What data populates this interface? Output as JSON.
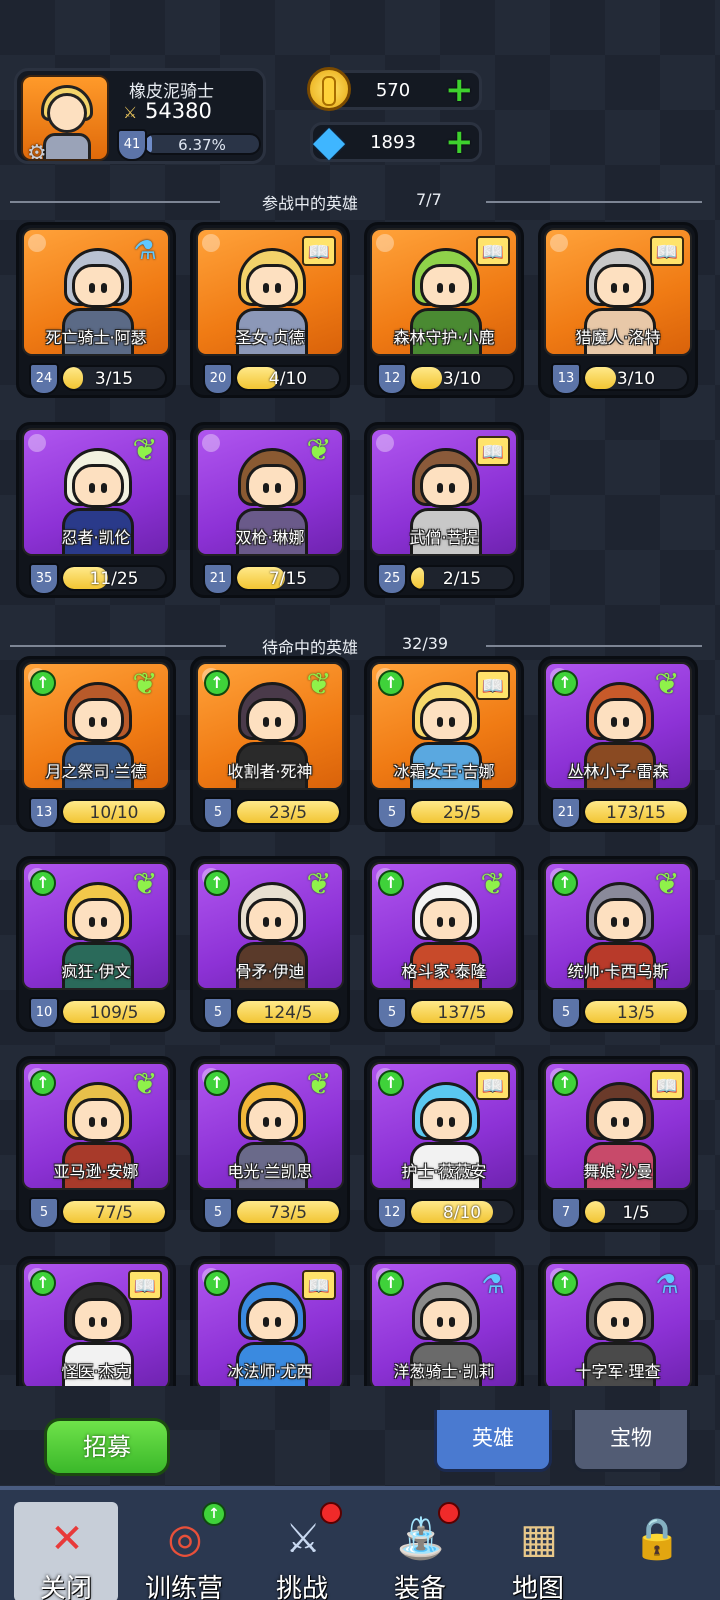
{
  "player": {
    "name": "橡皮泥骑士",
    "power": "54380",
    "level": "41",
    "exp_percent": "6.37%",
    "exp_fraction": 0.0637
  },
  "resources": {
    "coins": "570",
    "gems": "1893"
  },
  "icons": {
    "settings": "gear-icon",
    "power": "crossed-swords-icon",
    "coin": "gold-coin-icon",
    "gem": "diamond-icon",
    "add": "plus-icon"
  },
  "active_section": {
    "title": "参战中的英雄",
    "count": "7/7"
  },
  "active_heroes": [
    {
      "name": "死亡骑士·阿瑟",
      "level": "24",
      "progress": "3/15",
      "frac": 0.2,
      "rarity": "orange",
      "badge": "potion",
      "hair": "#b9c2d2",
      "outfit": "#5b6a86"
    },
    {
      "name": "圣女·贞德",
      "level": "20",
      "progress": "4/10",
      "frac": 0.4,
      "rarity": "orange",
      "badge": "book",
      "hair": "#f2d26a",
      "outfit": "#8c98b8"
    },
    {
      "name": "森林守护·小鹿",
      "level": "12",
      "progress": "3/10",
      "frac": 0.3,
      "rarity": "orange",
      "badge": "book",
      "hair": "#8fd24a",
      "outfit": "#4a8a32"
    },
    {
      "name": "猎魔人·洛特",
      "level": "13",
      "progress": "3/10",
      "frac": 0.3,
      "rarity": "orange",
      "badge": "book",
      "hair": "#c8c8c8",
      "outfit": "#e8c8a8"
    },
    {
      "name": "忍者·凯伦",
      "level": "35",
      "progress": "11/25",
      "frac": 0.44,
      "rarity": "purple",
      "badge": "wing",
      "hair": "#f2f2e0",
      "outfit": "#2a3a8a"
    },
    {
      "name": "双枪·琳娜",
      "level": "21",
      "progress": "7/15",
      "frac": 0.47,
      "rarity": "purple",
      "badge": "wing",
      "hair": "#8a5a32",
      "outfit": "#6a5a8a"
    },
    {
      "name": "武僧·菩提",
      "level": "25",
      "progress": "2/15",
      "frac": 0.13,
      "rarity": "purple",
      "badge": "book",
      "hair": "#8a5a3a",
      "outfit": "#c8c8c8"
    }
  ],
  "standby_section": {
    "title": "待命中的英雄",
    "count": "32/39"
  },
  "standby_heroes": [
    {
      "name": "月之祭司·兰德",
      "level": "13",
      "progress": "10/10",
      "frac": 1,
      "rarity": "orange",
      "badge": "wing",
      "hair": "#b85a2a",
      "outfit": "#3a5a8a"
    },
    {
      "name": "收割者·死神",
      "level": "5",
      "progress": "23/5",
      "frac": 1,
      "rarity": "orange",
      "badge": "wing",
      "hair": "#4a3a4a",
      "outfit": "#2a2a2a"
    },
    {
      "name": "冰霜女王·吉娜",
      "level": "5",
      "progress": "25/5",
      "frac": 1,
      "rarity": "orange",
      "badge": "book",
      "hair": "#f6d86a",
      "outfit": "#5aa8e0"
    },
    {
      "name": "丛林小子·雷森",
      "level": "21",
      "progress": "173/15",
      "frac": 1,
      "rarity": "purple",
      "badge": "wing",
      "hair": "#c85a2a",
      "outfit": "#8a4a22"
    },
    {
      "name": "疯狂·伊文",
      "level": "10",
      "progress": "109/5",
      "frac": 1,
      "rarity": "purple",
      "badge": "wing",
      "hair": "#f2c84a",
      "outfit": "#2a6a5a"
    },
    {
      "name": "骨矛·伊迪",
      "level": "5",
      "progress": "124/5",
      "frac": 1,
      "rarity": "purple",
      "badge": "wing",
      "hair": "#e8e0d0",
      "outfit": "#5a3a2a"
    },
    {
      "name": "格斗家·泰隆",
      "level": "5",
      "progress": "137/5",
      "frac": 1,
      "rarity": "purple",
      "badge": "wing",
      "hair": "#f2f2f2",
      "outfit": "#c84a2a"
    },
    {
      "name": "统帅·卡西乌斯",
      "level": "5",
      "progress": "13/5",
      "frac": 1,
      "rarity": "purple",
      "badge": "wing",
      "hair": "#8a8a9a",
      "outfit": "#b83a2a"
    },
    {
      "name": "亚马逊·安娜",
      "level": "5",
      "progress": "77/5",
      "frac": 1,
      "rarity": "purple",
      "badge": "wing",
      "hair": "#e8c04a",
      "outfit": "#a83a2a"
    },
    {
      "name": "电光·兰凯思",
      "level": "5",
      "progress": "73/5",
      "frac": 1,
      "rarity": "purple",
      "badge": "wing",
      "hair": "#f2b83a",
      "outfit": "#6a6a8a"
    },
    {
      "name": "护士·薇薇安",
      "level": "12",
      "progress": "8/10",
      "frac": 0.8,
      "rarity": "purple",
      "badge": "book",
      "hair": "#5ac8f0",
      "outfit": "#f2f2f2"
    },
    {
      "name": "舞娘·沙曼",
      "level": "7",
      "progress": "1/5",
      "frac": 0.2,
      "rarity": "purple",
      "badge": "book",
      "hair": "#6a3a2a",
      "outfit": "#c84a6a"
    },
    {
      "name": "怪医·杰克",
      "level": "",
      "progress": "",
      "frac": 0,
      "rarity": "purple",
      "badge": "book",
      "hair": "#2a2a2a",
      "outfit": "#f2f2f2"
    },
    {
      "name": "冰法师·尤西",
      "level": "",
      "progress": "",
      "frac": 0,
      "rarity": "purple",
      "badge": "book",
      "hair": "#3a8ae0",
      "outfit": "#3a8ae0"
    },
    {
      "name": "洋葱骑士·凯莉",
      "level": "",
      "progress": "",
      "frac": 0,
      "rarity": "purple",
      "badge": "potion",
      "hair": "#8a8a8a",
      "outfit": "#6a6a6a"
    },
    {
      "name": "十字军·理查",
      "level": "",
      "progress": "",
      "frac": 0,
      "rarity": "purple",
      "badge": "potion",
      "hair": "#5a5a5a",
      "outfit": "#4a4a4a"
    }
  ],
  "actions": {
    "recruit": "招募",
    "tab_heroes": "英雄",
    "tab_treasure": "宝物"
  },
  "nav": [
    {
      "label": "关闭",
      "icon": "close-icon",
      "glyph": "✕",
      "color": "#e83a3a"
    },
    {
      "label": "训练营",
      "icon": "training-target-icon",
      "glyph": "◎",
      "color": "#e8503a",
      "notify": "up"
    },
    {
      "label": "挑战",
      "icon": "sword-icon",
      "glyph": "⚔",
      "color": "#c8d8f0",
      "notify": "dot"
    },
    {
      "label": "装备",
      "icon": "watering-can-icon",
      "glyph": "⛲",
      "color": "#4ab8f0",
      "notify": "dot"
    },
    {
      "label": "地图",
      "icon": "treasure-map-icon",
      "glyph": "▦",
      "color": "#e8c88a"
    },
    {
      "label": "",
      "icon": "locked-icon",
      "glyph": "🔒",
      "color": "#8a8a8a"
    }
  ],
  "colors": {
    "progress_fill": "#f2c533",
    "level_shield": "#5c74a8",
    "plus": "#3ed12e",
    "notify_dot": "#f02a2a"
  }
}
